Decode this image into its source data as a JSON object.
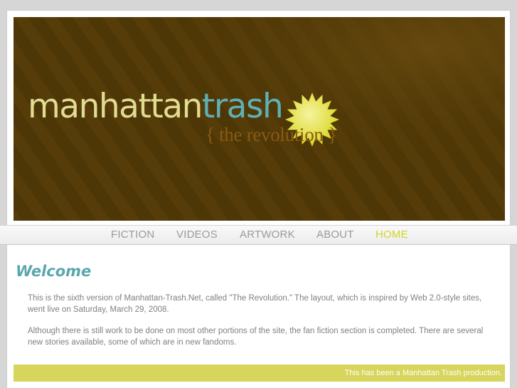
{
  "banner": {
    "logo_part1": "manhattan",
    "logo_part2": "trash",
    "tagline": "{ the revolution }",
    "colors": {
      "background": "#4e3706",
      "manhattan": "#e2dc93",
      "trash": "#5fb0b6",
      "tagline": "#8a5a12",
      "star": "#e6e43a"
    }
  },
  "nav": {
    "items": [
      {
        "label": "FICTION",
        "active": false
      },
      {
        "label": "VIDEOS",
        "active": false
      },
      {
        "label": "ARTWORK",
        "active": false
      },
      {
        "label": "ABOUT",
        "active": false
      },
      {
        "label": "HOME",
        "active": true
      }
    ],
    "colors": {
      "default": "#9a9a9a",
      "active": "#d2d627"
    }
  },
  "main": {
    "heading": "Welcome",
    "paragraphs": [
      "This is the sixth version of Manhattan-Trash.Net, called \"The Revolution.\" The layout, which is inspired by Web 2.0-style sites, went live on Saturday, March 29, 2008.",
      "Although there is still work to be done on most other portions of the site, the fan fiction section is completed. There are several new stories available, some of which are in new fandoms."
    ]
  },
  "footer": {
    "text": "This has been a Manhattan Trash production.",
    "color": "#d7d55c"
  }
}
